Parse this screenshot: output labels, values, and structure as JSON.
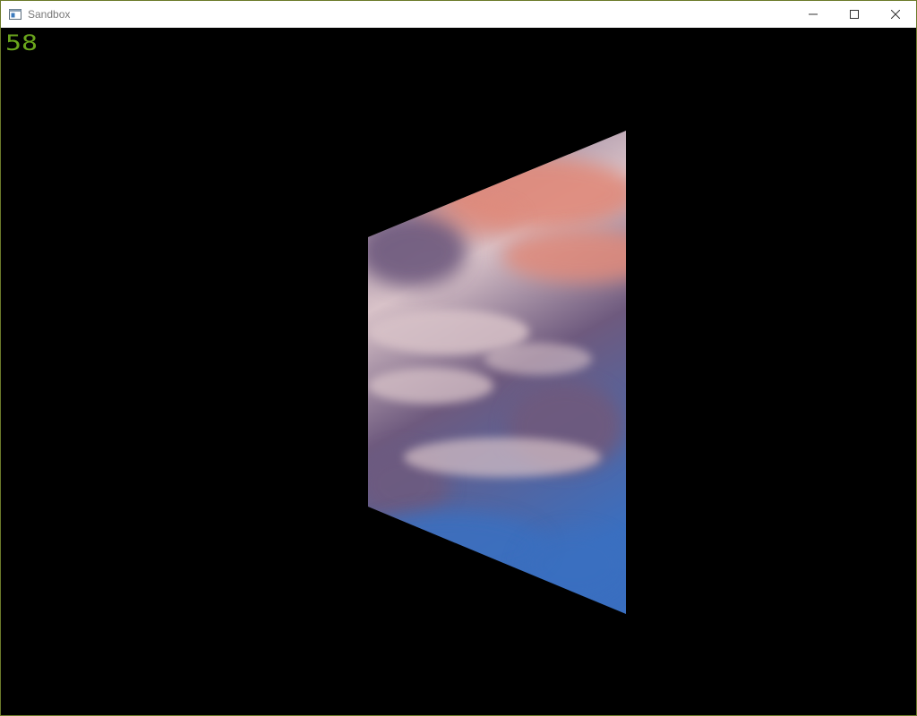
{
  "window": {
    "title": "Sandbox",
    "icon": "app-window-icon",
    "controls": [
      "minimize-icon",
      "maximize-icon",
      "close-icon"
    ]
  },
  "overlay": {
    "fps_counter": "58",
    "fps_color": "#6aa51c"
  },
  "scene": {
    "object": "textured-quad",
    "texture": "cloudy-sky",
    "colors": {
      "cloud_pink": "#e08a7a",
      "cloud_purple": "#6e5a7e",
      "cloud_light": "#d8c2c8",
      "sky_blue": "#3a6fc0",
      "background": "#000000"
    }
  }
}
